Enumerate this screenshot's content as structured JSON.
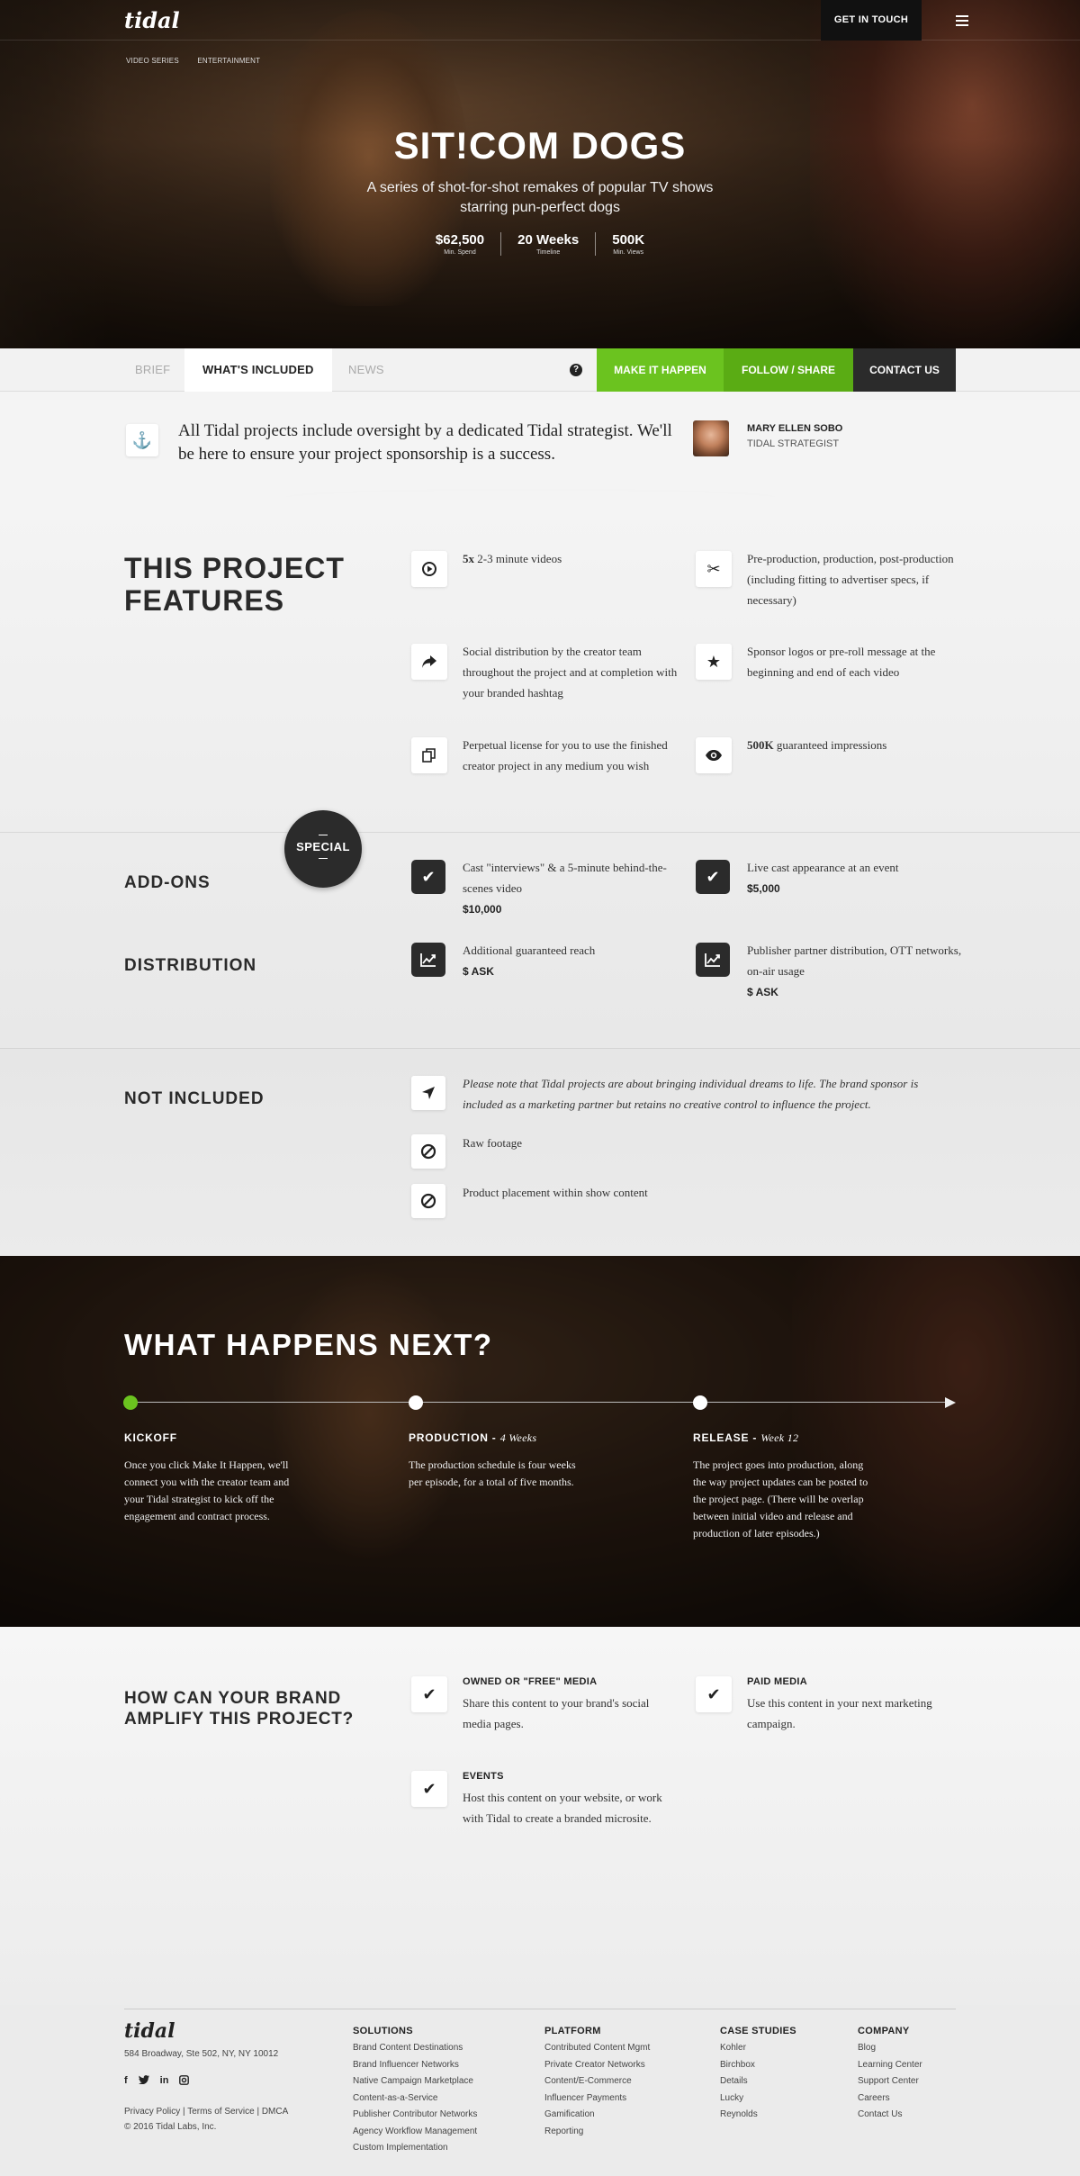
{
  "header": {
    "logo": "tidal",
    "get_in_touch": "GET IN TOUCH",
    "breadcrumbs": [
      "VIDEO SERIES",
      "ENTERTAINMENT"
    ]
  },
  "hero": {
    "title": "SIT!COM DOGS",
    "subtitle": "A series of shot-for-shot remakes of popular TV shows starring pun-perfect dogs",
    "stats": [
      {
        "value": "$62,500",
        "label": "Min. Spend"
      },
      {
        "value": "20 Weeks",
        "label": "Timeline"
      },
      {
        "value": "500K",
        "label": "Min. Views"
      }
    ]
  },
  "tabs": {
    "items": [
      "BRIEF",
      "WHAT'S INCLUDED",
      "NEWS"
    ],
    "active": "WHAT'S INCLUDED",
    "help": "?",
    "make_it_happen": "MAKE IT HAPPEN",
    "follow_share": "FOLLOW / SHARE",
    "contact_us": "CONTACT US",
    "colors": {
      "make_it_happen": "#6bc31f",
      "follow_share": "#5aac14",
      "contact_us": "#2b2b2b"
    }
  },
  "strategist": {
    "message": "All Tidal projects include oversight by a dedicated Tidal strategist. We'll be here to ensure your project sponsorship is a success.",
    "name": "MARY ELLEN SOBO",
    "role": "TIDAL STRATEGIST"
  },
  "features": {
    "title_line1": "THIS PROJECT",
    "title_line2": "FEATURES",
    "items": [
      {
        "icon": "play-circle-icon",
        "bold": "5x",
        "text": " 2-3 minute videos"
      },
      {
        "icon": "scissors-icon",
        "bold": "",
        "text": "Pre-production, production, post-production (including fitting to advertiser specs, if necessary)"
      },
      {
        "icon": "share-arrow-icon",
        "bold": "",
        "text": "Social distribution by the creator team throughout the project and at completion with your branded hashtag"
      },
      {
        "icon": "star-icon",
        "bold": "",
        "text": "Sponsor logos or pre-roll message at the beginning and end of each video"
      },
      {
        "icon": "copy-icon",
        "bold": "",
        "text": "Perpetual license for you to use the finished creator project in any medium you wish"
      },
      {
        "icon": "eye-icon",
        "bold": "500K",
        "text": " guaranteed impressions"
      }
    ]
  },
  "addons": {
    "special_badge": "SPECIAL",
    "addons_title": "ADD-ONS",
    "distribution_title": "DISTRIBUTION",
    "addon_items": [
      {
        "text": "Cast \"interviews\" & a 5-minute behind-the-scenes video",
        "price": "$10,000"
      },
      {
        "text": "Live cast appearance at an event",
        "price": "$5,000"
      }
    ],
    "distribution_items": [
      {
        "text": "Additional guaranteed reach",
        "price": "$ ASK"
      },
      {
        "text": "Publisher partner distribution, OTT networks, on-air usage",
        "price": "$ ASK"
      }
    ]
  },
  "not_included": {
    "title": "NOT INCLUDED",
    "note": "Please note that Tidal projects are about bringing individual dreams to life. The brand sponsor is included as a marketing partner but retains no creative control to influence the project.",
    "items": [
      "Raw footage",
      "Product placement within show content"
    ]
  },
  "next": {
    "title": "WHAT HAPPENS NEXT?",
    "accent": "#6bc31f",
    "steps": [
      {
        "title": "KICKOFF",
        "duration": "",
        "text": "Once you click Make It Happen, we'll connect you with the creator team and your Tidal strategist to kick off the engagement and contract process."
      },
      {
        "title": "PRODUCTION - ",
        "duration": "4 Weeks",
        "text": "The production schedule is four weeks per episode, for a total of five months."
      },
      {
        "title": "RELEASE - ",
        "duration": "Week 12",
        "text": "The project goes into production, along the way project updates can be posted to the project page. (There will be overlap between initial video and release and production of later episodes.)"
      }
    ]
  },
  "amplify": {
    "title": "HOW CAN YOUR BRAND AMPLIFY THIS PROJECT?",
    "items": [
      {
        "heading": "OWNED OR \"FREE\" MEDIA",
        "text": "Share this content to your brand's social media pages."
      },
      {
        "heading": "PAID MEDIA",
        "text": "Use this content in your next marketing campaign."
      },
      {
        "heading": "EVENTS",
        "text": "Host this content on your website, or work with Tidal to create a branded microsite."
      }
    ]
  },
  "footer": {
    "logo": "tidal",
    "address": "584 Broadway, Ste 502, NY, NY 10012",
    "social": [
      "f",
      "t",
      "in",
      "ig"
    ],
    "legal_line1": "Privacy Policy | Terms of Service | DMCA",
    "legal_line2": "© 2016 Tidal Labs, Inc.",
    "columns": [
      {
        "heading": "SOLUTIONS",
        "links": [
          "Brand Content Destinations",
          "Brand Influencer Networks",
          "Native Campaign Marketplace",
          "Content-as-a-Service",
          "Publisher Contributor Networks",
          "Agency Workflow Management",
          "Custom Implementation"
        ]
      },
      {
        "heading": "PLATFORM",
        "links": [
          "Contributed Content Mgmt",
          "Private Creator Networks",
          "Content/E-Commerce",
          "Influencer Payments",
          "Gamification",
          "Reporting"
        ]
      },
      {
        "heading": "CASE STUDIES",
        "links": [
          "Kohler",
          "Birchbox",
          "Details",
          "Lucky",
          "Reynolds"
        ]
      },
      {
        "heading": "COMPANY",
        "links": [
          "Blog",
          "Learning Center",
          "Support Center",
          "Careers",
          "Contact Us"
        ]
      }
    ]
  }
}
